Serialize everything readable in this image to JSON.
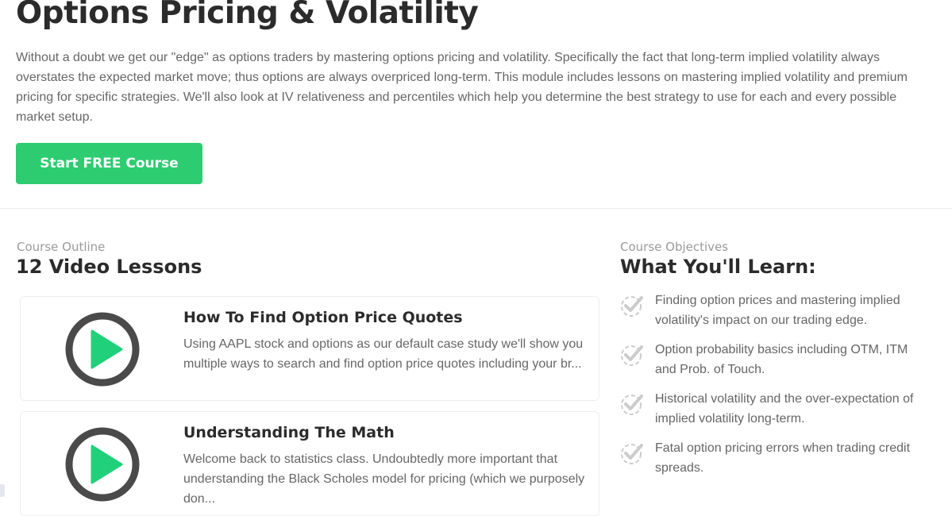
{
  "header": {
    "title": "Options Pricing & Volatility",
    "description": "Without a doubt we get our \"edge\" as options traders by mastering options pricing and volatility. Specifically the fact that long-term implied volatility always overstates the expected market move; thus options are always overpriced long-term. This module includes lessons on mastering implied volatility and premium pricing for specific strategies. We'll also look at IV relativeness and percentiles which help you determine the best strategy to use for each and every possible market setup.",
    "cta_label": "Start FREE Course"
  },
  "outline": {
    "kicker": "Course Outline",
    "heading": "12 Video Lessons",
    "lessons": [
      {
        "title": "How To Find Option Price Quotes",
        "description": "Using AAPL stock and options as our default case study we'll show you multiple ways to search and find option price quotes including your br...",
        "icon": "play-icon"
      },
      {
        "title": "Understanding The Math",
        "description": "Welcome back to statistics class. Undoubtedly more important that understanding the Black Scholes model for pricing (which we purposely don...",
        "icon": "play-icon"
      }
    ]
  },
  "objectives": {
    "kicker": "Course Objectives",
    "heading": "What You'll Learn:",
    "items": [
      {
        "text": "Finding option prices and mastering implied volatility's impact on our trading edge.",
        "icon": "check-badge-icon"
      },
      {
        "text": "Option probability basics including OTM, ITM and Prob. of Touch.",
        "icon": "check-badge-icon"
      },
      {
        "text": "Historical volatility and the over-expectation of implied volatility long-term.",
        "icon": "check-badge-icon"
      },
      {
        "text": "Fatal option pricing errors when trading credit spreads.",
        "icon": "check-badge-icon"
      }
    ]
  },
  "colors": {
    "accent": "#2ecc71",
    "play_ring": "#4a4a4a",
    "play_triangle": "#21d07a",
    "check": "#cccccc",
    "heading": "#2b2b2b",
    "body_text": "#666666"
  }
}
